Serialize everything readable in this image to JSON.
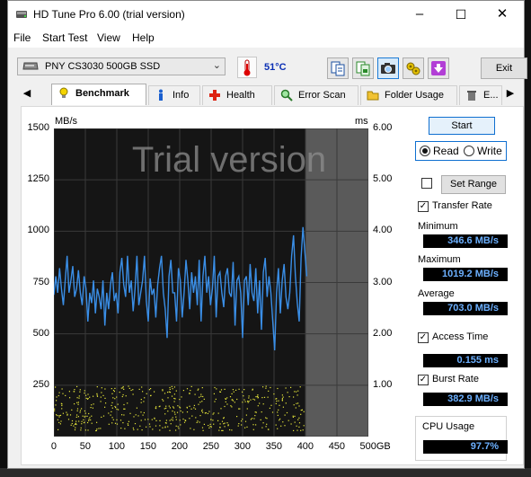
{
  "window": {
    "title": "HD Tune Pro 6.00 (trial version)",
    "controls": [
      "–",
      "☐",
      "✕"
    ]
  },
  "menu": [
    "File",
    "Start Test",
    "View",
    "Help"
  ],
  "toolbar": {
    "drive": "PNY CS3030 500GB SSD",
    "temperature": "51°C",
    "exit_label": "Exit"
  },
  "tabs": [
    {
      "label": "Benchmark",
      "icon": "lightbulb-icon",
      "active": true
    },
    {
      "label": "Info",
      "icon": "info-icon"
    },
    {
      "label": "Health",
      "icon": "health-cross-icon"
    },
    {
      "label": "Error Scan",
      "icon": "magnifier-icon"
    },
    {
      "label": "Folder Usage",
      "icon": "folder-icon"
    },
    {
      "label": "E...",
      "icon": "trash-icon"
    }
  ],
  "chart_data": {
    "type": "line",
    "watermark": "Trial version",
    "left_unit": "MB/s",
    "right_unit": "ms",
    "y_left_ticks": [
      "1500",
      "1250",
      "1000",
      "750",
      "500",
      "250"
    ],
    "y_right_ticks": [
      "6.00",
      "5.00",
      "4.00",
      "3.00",
      "2.00",
      "1.00"
    ],
    "x_ticks": [
      "0",
      "50",
      "100",
      "150",
      "200",
      "250",
      "300",
      "350",
      "400",
      "450",
      "500GB"
    ],
    "xlim": [
      0,
      500
    ],
    "ylim_left": [
      0,
      1500
    ],
    "ylim_right": [
      0,
      6
    ],
    "tested_until_gb": 400,
    "series": [
      {
        "unit": "MB/s",
        "color": "#3a8ee6",
        "x": [
          0,
          3,
          6,
          9,
          12,
          15,
          18,
          21,
          24,
          27,
          30,
          33,
          36,
          39,
          42,
          45,
          48,
          51,
          54,
          57,
          60,
          63,
          66,
          69,
          72,
          75,
          78,
          81,
          84,
          87,
          90,
          93,
          96,
          99,
          102,
          105,
          108,
          111,
          114,
          117,
          120,
          123,
          126,
          129,
          132,
          135,
          138,
          141,
          144,
          147,
          150,
          153,
          156,
          159,
          162,
          165,
          168,
          171,
          174,
          177,
          180,
          183,
          186,
          189,
          192,
          195,
          198,
          201,
          204,
          207,
          210,
          213,
          216,
          219,
          222,
          225,
          228,
          231,
          234,
          237,
          240,
          243,
          246,
          249,
          252,
          255,
          258,
          261,
          264,
          267,
          270,
          273,
          276,
          279,
          282,
          285,
          288,
          291,
          294,
          297,
          300,
          303,
          306,
          309,
          312,
          315,
          318,
          321,
          324,
          327,
          330,
          333,
          336,
          339,
          342,
          345,
          348,
          351,
          354,
          357,
          360,
          363,
          366,
          369,
          372,
          375,
          378,
          381,
          384,
          387,
          390,
          393,
          396,
          399,
          402
        ],
        "y": [
          690,
          780,
          700,
          820,
          720,
          640,
          760,
          880,
          700,
          760,
          830,
          680,
          720,
          810,
          700,
          640,
          780,
          720,
          560,
          700,
          650,
          760,
          600,
          720,
          680,
          620,
          760,
          540,
          700,
          620,
          740,
          800,
          660,
          700,
          600,
          800,
          870,
          740,
          680,
          880,
          700,
          760,
          610,
          720,
          880,
          640,
          700,
          760,
          880,
          660,
          560,
          770,
          690,
          720,
          580,
          740,
          820,
          880,
          700,
          620,
          480,
          780,
          860,
          700,
          700,
          560,
          820,
          760,
          580,
          700,
          860,
          760,
          620,
          800,
          700,
          780,
          640,
          860,
          560,
          780,
          880,
          700,
          780,
          640,
          720,
          880,
          580,
          780,
          800,
          700,
          630,
          780,
          820,
          700,
          680,
          850,
          540,
          760,
          780,
          700,
          480,
          760,
          780,
          640,
          840,
          700,
          660,
          820,
          600,
          760,
          520,
          800,
          870,
          680,
          780,
          700,
          560,
          420,
          700,
          820,
          600,
          760,
          840,
          680,
          620,
          700,
          880,
          980,
          780,
          650,
          560,
          870,
          1020,
          900,
          780
        ]
      }
    ]
  },
  "controls": {
    "start_label": "Start",
    "read_label": "Read",
    "write_label": "Write",
    "read_selected": true,
    "set_range_label": "Set Range",
    "transfer_rate_label": "Transfer Rate",
    "transfer_rate_checked": true,
    "minimum_label": "Minimum",
    "minimum_value": "346.6 MB/s",
    "maximum_label": "Maximum",
    "maximum_value": "1019.2 MB/s",
    "average_label": "Average",
    "average_value": "703.0 MB/s",
    "access_time_label": "Access Time",
    "access_time_checked": true,
    "access_time_value": "0.155 ms",
    "burst_rate_label": "Burst Rate",
    "burst_rate_checked": true,
    "burst_rate_value": "382.9 MB/s",
    "cpu_usage_label": "CPU Usage",
    "cpu_usage_value": "97.7%"
  }
}
